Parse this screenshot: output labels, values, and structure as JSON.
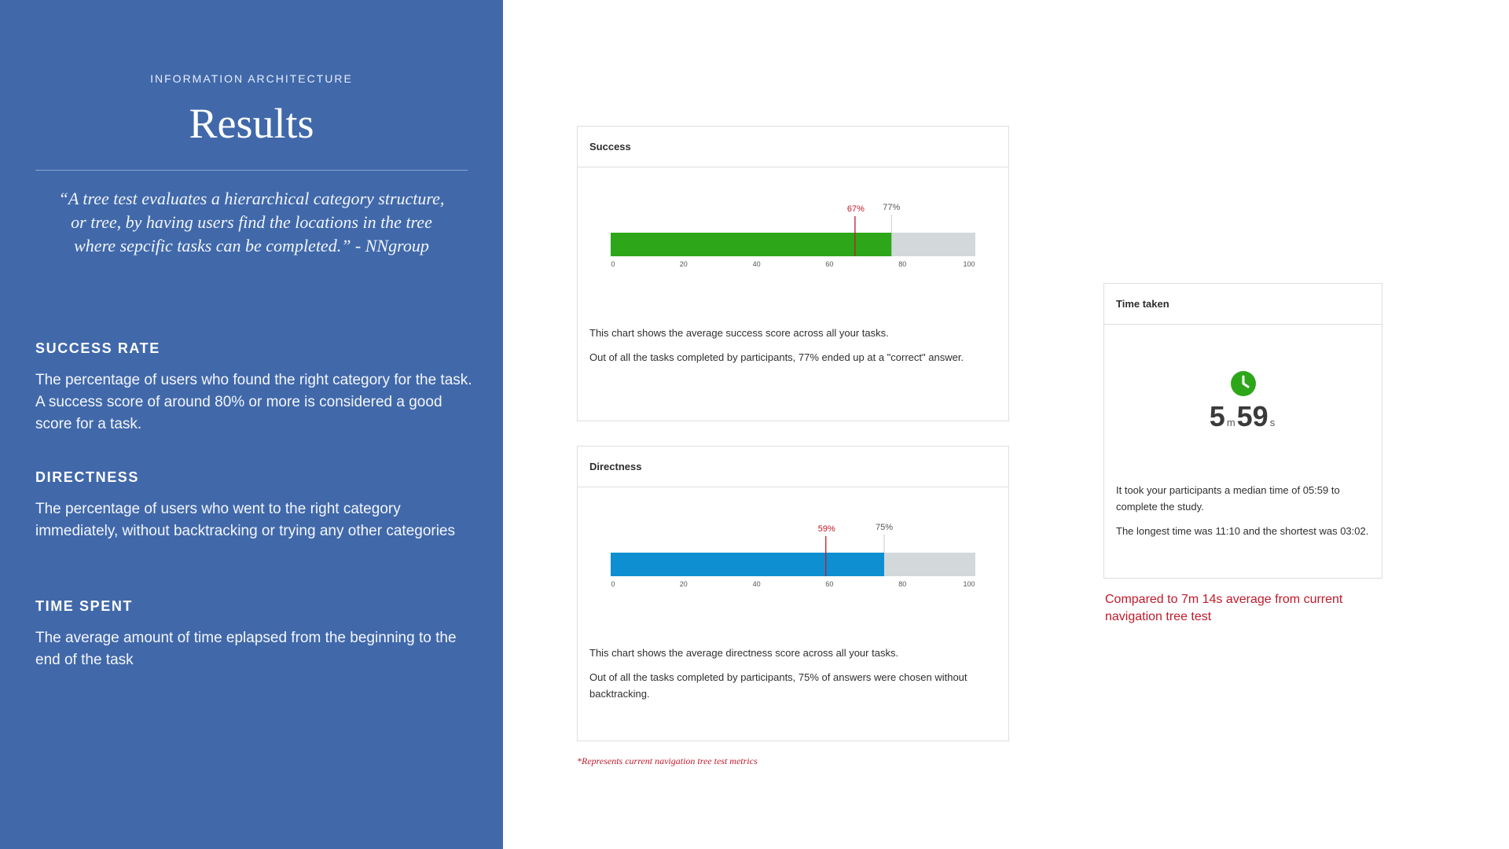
{
  "left": {
    "eyebrow": "INFORMATION ARCHITECTURE",
    "title": "Results",
    "quote": "“A tree test evaluates a hierarchical category structure, or tree, by having users find the locations in the tree where sepcific tasks can be completed.” - NNgroup",
    "sections": [
      {
        "heading": "SUCCESS RATE",
        "body": "The percentage of users who found the right category for the task. A success score of around 80% or more is considered a good score for a task."
      },
      {
        "heading": "DIRECTNESS",
        "body": "The percentage of users who went to the right category immediately, without backtracking or trying any other categories"
      },
      {
        "heading": "TIME SPENT",
        "body": "The average amount of time eplapsed from the beginning to the end of the task"
      }
    ]
  },
  "success": {
    "title": "Success",
    "desc1": "This chart shows the average success score across all your tasks.",
    "desc2": "Out of all the tasks completed by participants, 77% ended up at a \"correct\" answer."
  },
  "directness": {
    "title": "Directness",
    "desc1": "This chart shows the average directness score across all your tasks.",
    "desc2": "Out of all the tasks completed by participants, 75% of answers were chosen without backtracking."
  },
  "footnote": "*Represents current navigation tree test metrics",
  "time": {
    "title": "Time taken",
    "minutes": "5",
    "minutes_unit": "m",
    "seconds": "59",
    "seconds_unit": "s",
    "desc1": "It took your participants a median time of 05:59 to complete the study.",
    "desc2": "The longest time was 11:10 and the shortest was 03:02.",
    "compare": "Compared to 7m 14s average from current navigation tree test"
  },
  "colors": {
    "panel": "#4169aa",
    "success_bar": "#2ea61a",
    "directness_bar": "#0e8fd1",
    "track": "#d3d8da",
    "marker": "#c0192b",
    "clock": "#2ea61a"
  },
  "chart_data": [
    {
      "type": "bar",
      "name": "success",
      "value": 77,
      "value_label": "77%",
      "reference": 67,
      "reference_label": "67%",
      "xlim": [
        0,
        100
      ],
      "ticks": [
        0,
        20,
        40,
        60,
        80,
        100
      ],
      "tick_labels": [
        "0",
        "20",
        "40",
        "60",
        "80",
        "100"
      ]
    },
    {
      "type": "bar",
      "name": "directness",
      "value": 75,
      "value_label": "75%",
      "reference": 59,
      "reference_label": "59%",
      "xlim": [
        0,
        100
      ],
      "ticks": [
        0,
        20,
        40,
        60,
        80,
        100
      ],
      "tick_labels": [
        "0",
        "20",
        "40",
        "60",
        "80",
        "100"
      ]
    }
  ]
}
